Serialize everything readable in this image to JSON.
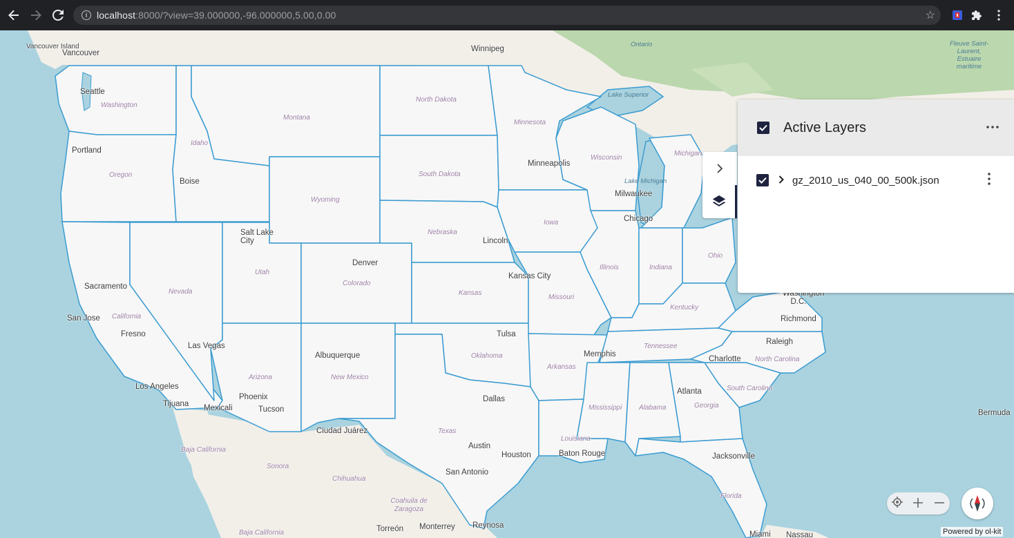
{
  "browser": {
    "url_host": "localhost",
    "url_rest": ":8000/?view=39.000000,-96.000000,5.00,0.00"
  },
  "map": {
    "state_labels": [
      {
        "name": "washington",
        "text": "Washington"
      },
      {
        "name": "oregon",
        "text": "Oregon"
      },
      {
        "name": "california",
        "text": "California"
      },
      {
        "name": "nevada",
        "text": "Nevada"
      },
      {
        "name": "idaho",
        "text": "Idaho"
      },
      {
        "name": "montana",
        "text": "Montana"
      },
      {
        "name": "wyoming",
        "text": "Wyoming"
      },
      {
        "name": "utah",
        "text": "Utah"
      },
      {
        "name": "arizona",
        "text": "Arizona"
      },
      {
        "name": "colorado",
        "text": "Colorado"
      },
      {
        "name": "new-mexico",
        "text": "New Mexico"
      },
      {
        "name": "north-dakota",
        "text": "North Dakota"
      },
      {
        "name": "south-dakota",
        "text": "South Dakota"
      },
      {
        "name": "nebraska",
        "text": "Nebraska"
      },
      {
        "name": "kansas",
        "text": "Kansas"
      },
      {
        "name": "oklahoma",
        "text": "Oklahoma"
      },
      {
        "name": "texas",
        "text": "Texas"
      },
      {
        "name": "minnesota",
        "text": "Minnesota"
      },
      {
        "name": "iowa",
        "text": "Iowa"
      },
      {
        "name": "missouri",
        "text": "Missouri"
      },
      {
        "name": "arkansas",
        "text": "Arkansas"
      },
      {
        "name": "louisiana",
        "text": "Louisiana"
      },
      {
        "name": "wisconsin",
        "text": "Wisconsin"
      },
      {
        "name": "illinois",
        "text": "Illinois"
      },
      {
        "name": "indiana",
        "text": "Indiana"
      },
      {
        "name": "ohio",
        "text": "Ohio"
      },
      {
        "name": "michigan",
        "text": "Michigan"
      },
      {
        "name": "kentucky",
        "text": "Kentucky"
      },
      {
        "name": "tennessee",
        "text": "Tennessee"
      },
      {
        "name": "mississippi",
        "text": "Mississippi"
      },
      {
        "name": "alabama",
        "text": "Alabama"
      },
      {
        "name": "georgia",
        "text": "Georgia"
      },
      {
        "name": "florida",
        "text": "Florida"
      },
      {
        "name": "south-carolina",
        "text": "South Carolina"
      },
      {
        "name": "north-carolina",
        "text": "North Carolina"
      },
      {
        "name": "baja-california-sur",
        "text": "Baja California"
      },
      {
        "name": "baja-california",
        "text": "Baja California"
      },
      {
        "name": "sonora",
        "text": "Sonora"
      },
      {
        "name": "chihuahua",
        "text": "Chihuahua"
      },
      {
        "name": "coahuila",
        "text": "Coahuila de Zaragoza"
      }
    ],
    "city_labels": [
      {
        "name": "vancouver-island",
        "text": "Vancouver Island"
      },
      {
        "name": "vancouver",
        "text": "Vancouver"
      },
      {
        "name": "winnipeg",
        "text": "Winnipeg"
      },
      {
        "name": "seattle",
        "text": "Seattle"
      },
      {
        "name": "portland",
        "text": "Portland"
      },
      {
        "name": "boise",
        "text": "Boise"
      },
      {
        "name": "salt-lake-city",
        "text": "Salt Lake City"
      },
      {
        "name": "sacramento",
        "text": "Sacramento"
      },
      {
        "name": "san-jose",
        "text": "San Jose"
      },
      {
        "name": "fresno",
        "text": "Fresno"
      },
      {
        "name": "las-vegas",
        "text": "Las Vegas"
      },
      {
        "name": "los-angeles",
        "text": "Los Angeles"
      },
      {
        "name": "tijuana",
        "text": "Tijuana"
      },
      {
        "name": "mexicali",
        "text": "Mexicali"
      },
      {
        "name": "phoenix",
        "text": "Phoenix"
      },
      {
        "name": "tucson",
        "text": "Tucson"
      },
      {
        "name": "albuquerque",
        "text": "Albuquerque"
      },
      {
        "name": "ciudad-juarez",
        "text": "Ciudad Juárez"
      },
      {
        "name": "denver",
        "text": "Denver"
      },
      {
        "name": "lincoln",
        "text": "Lincoln"
      },
      {
        "name": "kansas-city",
        "text": "Kansas City"
      },
      {
        "name": "tulsa",
        "text": "Tulsa"
      },
      {
        "name": "dallas",
        "text": "Dallas"
      },
      {
        "name": "austin",
        "text": "Austin"
      },
      {
        "name": "houston",
        "text": "Houston"
      },
      {
        "name": "san-antonio",
        "text": "San Antonio"
      },
      {
        "name": "minneapolis",
        "text": "Minneapolis"
      },
      {
        "name": "milwaukee",
        "text": "Milwaukee"
      },
      {
        "name": "chicago",
        "text": "Chicago"
      },
      {
        "name": "memphis",
        "text": "Memphis"
      },
      {
        "name": "baton-rouge",
        "text": "Baton Rouge"
      },
      {
        "name": "jacksonville",
        "text": "Jacksonville"
      },
      {
        "name": "charlotte",
        "text": "Charlotte"
      },
      {
        "name": "raleigh",
        "text": "Raleigh"
      },
      {
        "name": "richmond",
        "text": "Richmond"
      },
      {
        "name": "washington-dc",
        "text": "Washington D.C."
      },
      {
        "name": "torreon",
        "text": "Torreón"
      },
      {
        "name": "monterrey",
        "text": "Monterrey"
      },
      {
        "name": "reynosa",
        "text": "Reynosa"
      },
      {
        "name": "miami",
        "text": "Miami"
      },
      {
        "name": "nassau",
        "text": "Nassau"
      },
      {
        "name": "bermuda",
        "text": "Bermuda"
      }
    ],
    "water_labels": [
      {
        "name": "lake-superior",
        "text": "Lake Superior"
      },
      {
        "name": "lake-michigan",
        "text": "Lake Michigan"
      },
      {
        "name": "ontario",
        "text": "Ontario"
      },
      {
        "name": "fleuve",
        "text": "Fleuve Saint-Laurent, Estuaire maritime"
      }
    ]
  },
  "layers_panel": {
    "title": "Active Layers",
    "layer_name": "gz_2010_us_040_00_500k.json"
  },
  "attribution": "Powered by ol-kit",
  "colors": {
    "ocean": "#aad3df",
    "land": "#f2efe9",
    "state_fill": "#f7f7f7",
    "state_stroke": "#3a9bd1",
    "forest": "#add19e",
    "panel_accent": "#1f2340"
  }
}
